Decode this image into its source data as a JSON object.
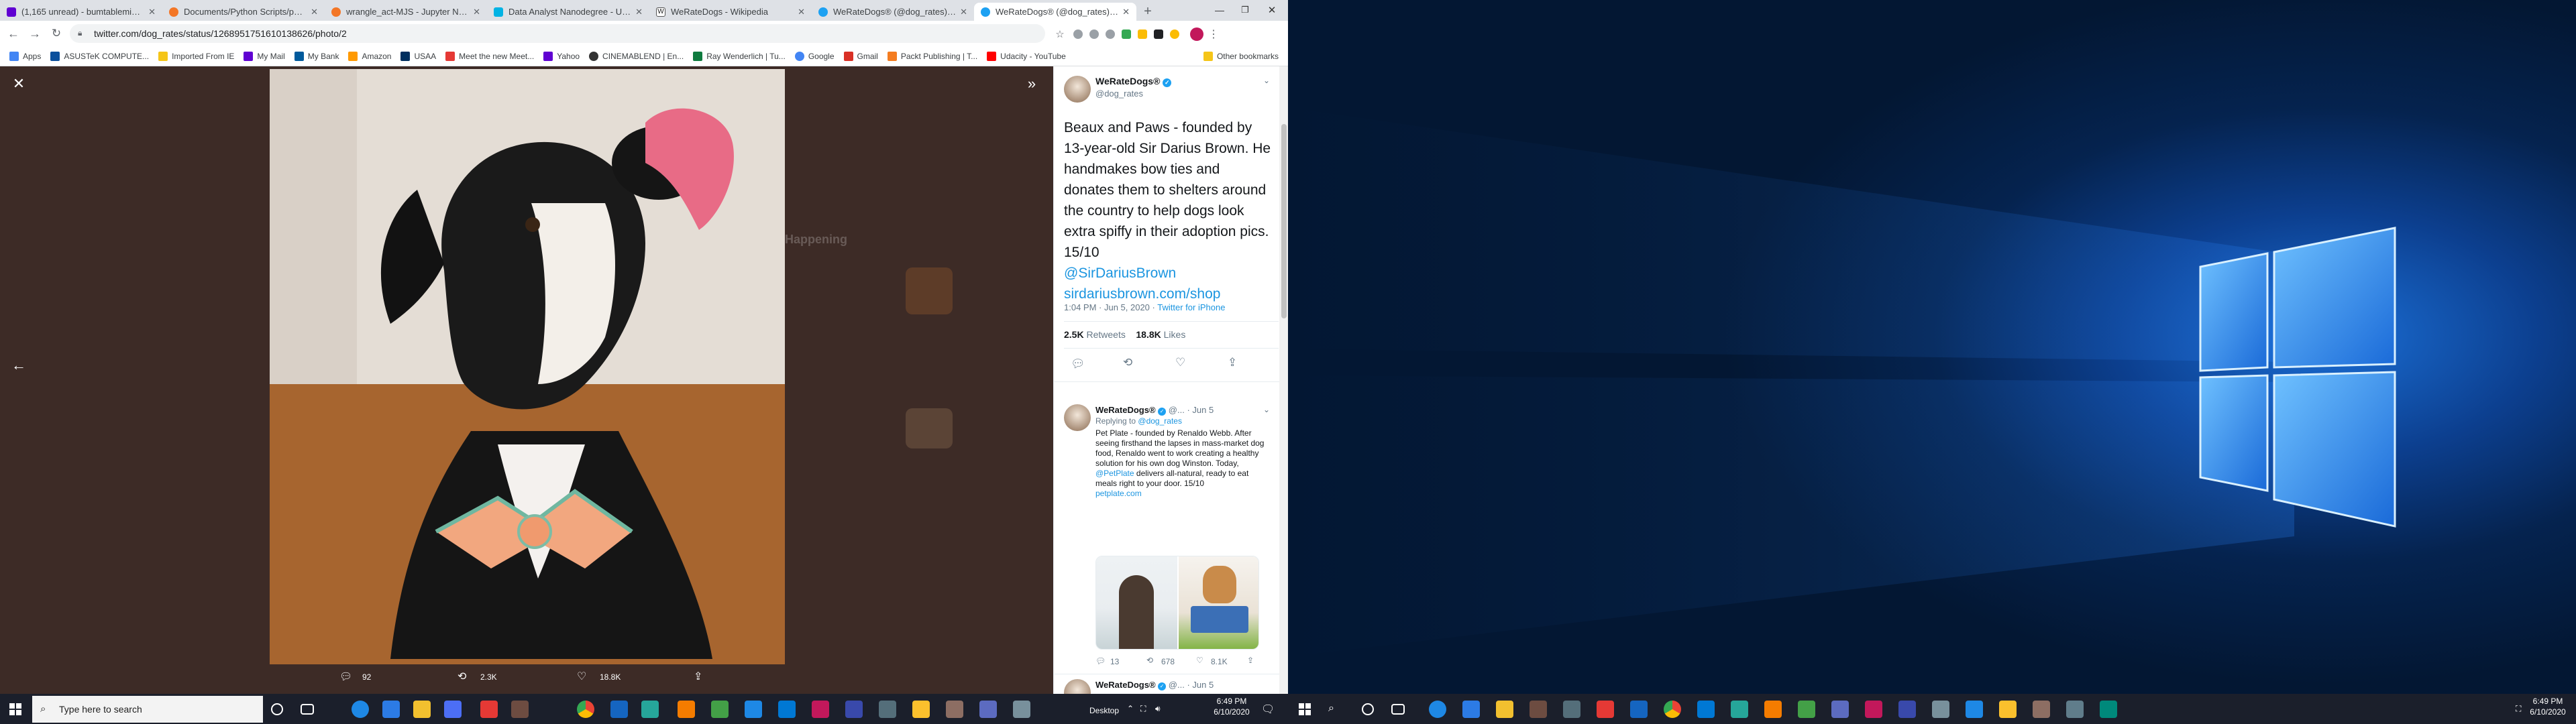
{
  "tabs": [
    {
      "title": "(1,165 unread) - bumtablemike@...",
      "color": "#6001d2"
    },
    {
      "title": "Documents/Python Scripts/pand...",
      "color": "#f37626"
    },
    {
      "title": "wrangle_act-MJS - Jupyter Notel...",
      "color": "#f37626"
    },
    {
      "title": "Data Analyst Nanodegree - Udaci...",
      "color": "#02b3e4"
    },
    {
      "title": "WeRateDogs - Wikipedia",
      "color": "#555555"
    },
    {
      "title": "WeRateDogs® (@dog_rates) | Tw...",
      "color": "#1da1f2"
    },
    {
      "title": "WeRateDogs® (@dog_rates) / T...",
      "color": "#1da1f2"
    }
  ],
  "address": "twitter.com/dog_rates/status/1268951751610138626/photo/2",
  "bookmarks": [
    {
      "label": "Apps",
      "color": "#4285f4"
    },
    {
      "label": "ASUSTeK COMPUTE...",
      "color": "#0b4f9c"
    },
    {
      "label": "Imported From IE",
      "color": "#f5c518"
    },
    {
      "label": "My Mail",
      "color": "#6001d2"
    },
    {
      "label": "My Bank",
      "color": "#005a9c"
    },
    {
      "label": "Amazon",
      "color": "#ff9900"
    },
    {
      "label": "USAA",
      "color": "#002f5f"
    },
    {
      "label": "Meet the new Meet...",
      "color": "#e53935"
    },
    {
      "label": "Yahoo",
      "color": "#6001d2"
    },
    {
      "label": "CINEMABLEND | En...",
      "color": "#333333"
    },
    {
      "label": "Ray Wenderlich | Tu...",
      "color": "#0f7b3f"
    },
    {
      "label": "Google",
      "color": "#4285f4"
    },
    {
      "label": "Gmail",
      "color": "#d93025"
    },
    {
      "label": "Packt Publishing | T...",
      "color": "#f47c20"
    },
    {
      "label": "Udacity - YouTube",
      "color": "#ff0000"
    }
  ],
  "other_bookmarks": "Other bookmarks",
  "viewer": {
    "replies": "92",
    "retweets": "2.3K",
    "likes": "18.8K"
  },
  "main_tweet": {
    "name": "WeRateDogs®",
    "handle": "@dog_rates",
    "text": "Beaux and Paws - founded by 13-year-old Sir Darius Brown. He handmakes bow ties and donates them to shelters around the country to help dogs look extra spiffy in their adoption pics. 15/10",
    "mention": "@SirDariusBrown",
    "url": "sirdariusbrown.com/shop",
    "time": "1:04 PM · Jun 5, 2020",
    "source": "Twitter for iPhone",
    "retweets": "2.5K",
    "retweets_label": "Retweets",
    "likes": "18.8K",
    "likes_label": "Likes"
  },
  "reply_tweet": {
    "name": "WeRateDogs®",
    "handle": "@...",
    "date": "· Jun 5",
    "replying_label": "Replying to",
    "replying_to": "@dog_rates",
    "text": "Pet Plate - founded by Renaldo Webb. After seeing firsthand the lapses in mass-market dog food, Renaldo went to work creating a healthy solution for his own dog Winston. Today,",
    "mention": "@PetPlate",
    "text2": "delivers all-natural, ready to eat meals right to your door. 15/10",
    "url": "petplate.com",
    "replies": "13",
    "retweets": "678",
    "likes": "8.1K"
  },
  "third_tweet": {
    "name": "WeRateDogs®",
    "handle": "@...",
    "date": "· Jun 5"
  },
  "background_text": {
    "trending": "Happening"
  },
  "taskbar_left": {
    "search_placeholder": "Type here to search"
  },
  "tray_left": {
    "desktop_label": "Desktop",
    "time": "6:49 PM",
    "date": "6/10/2020"
  },
  "tray_right": {
    "time": "6:49 PM",
    "date": "6/10/2020"
  }
}
